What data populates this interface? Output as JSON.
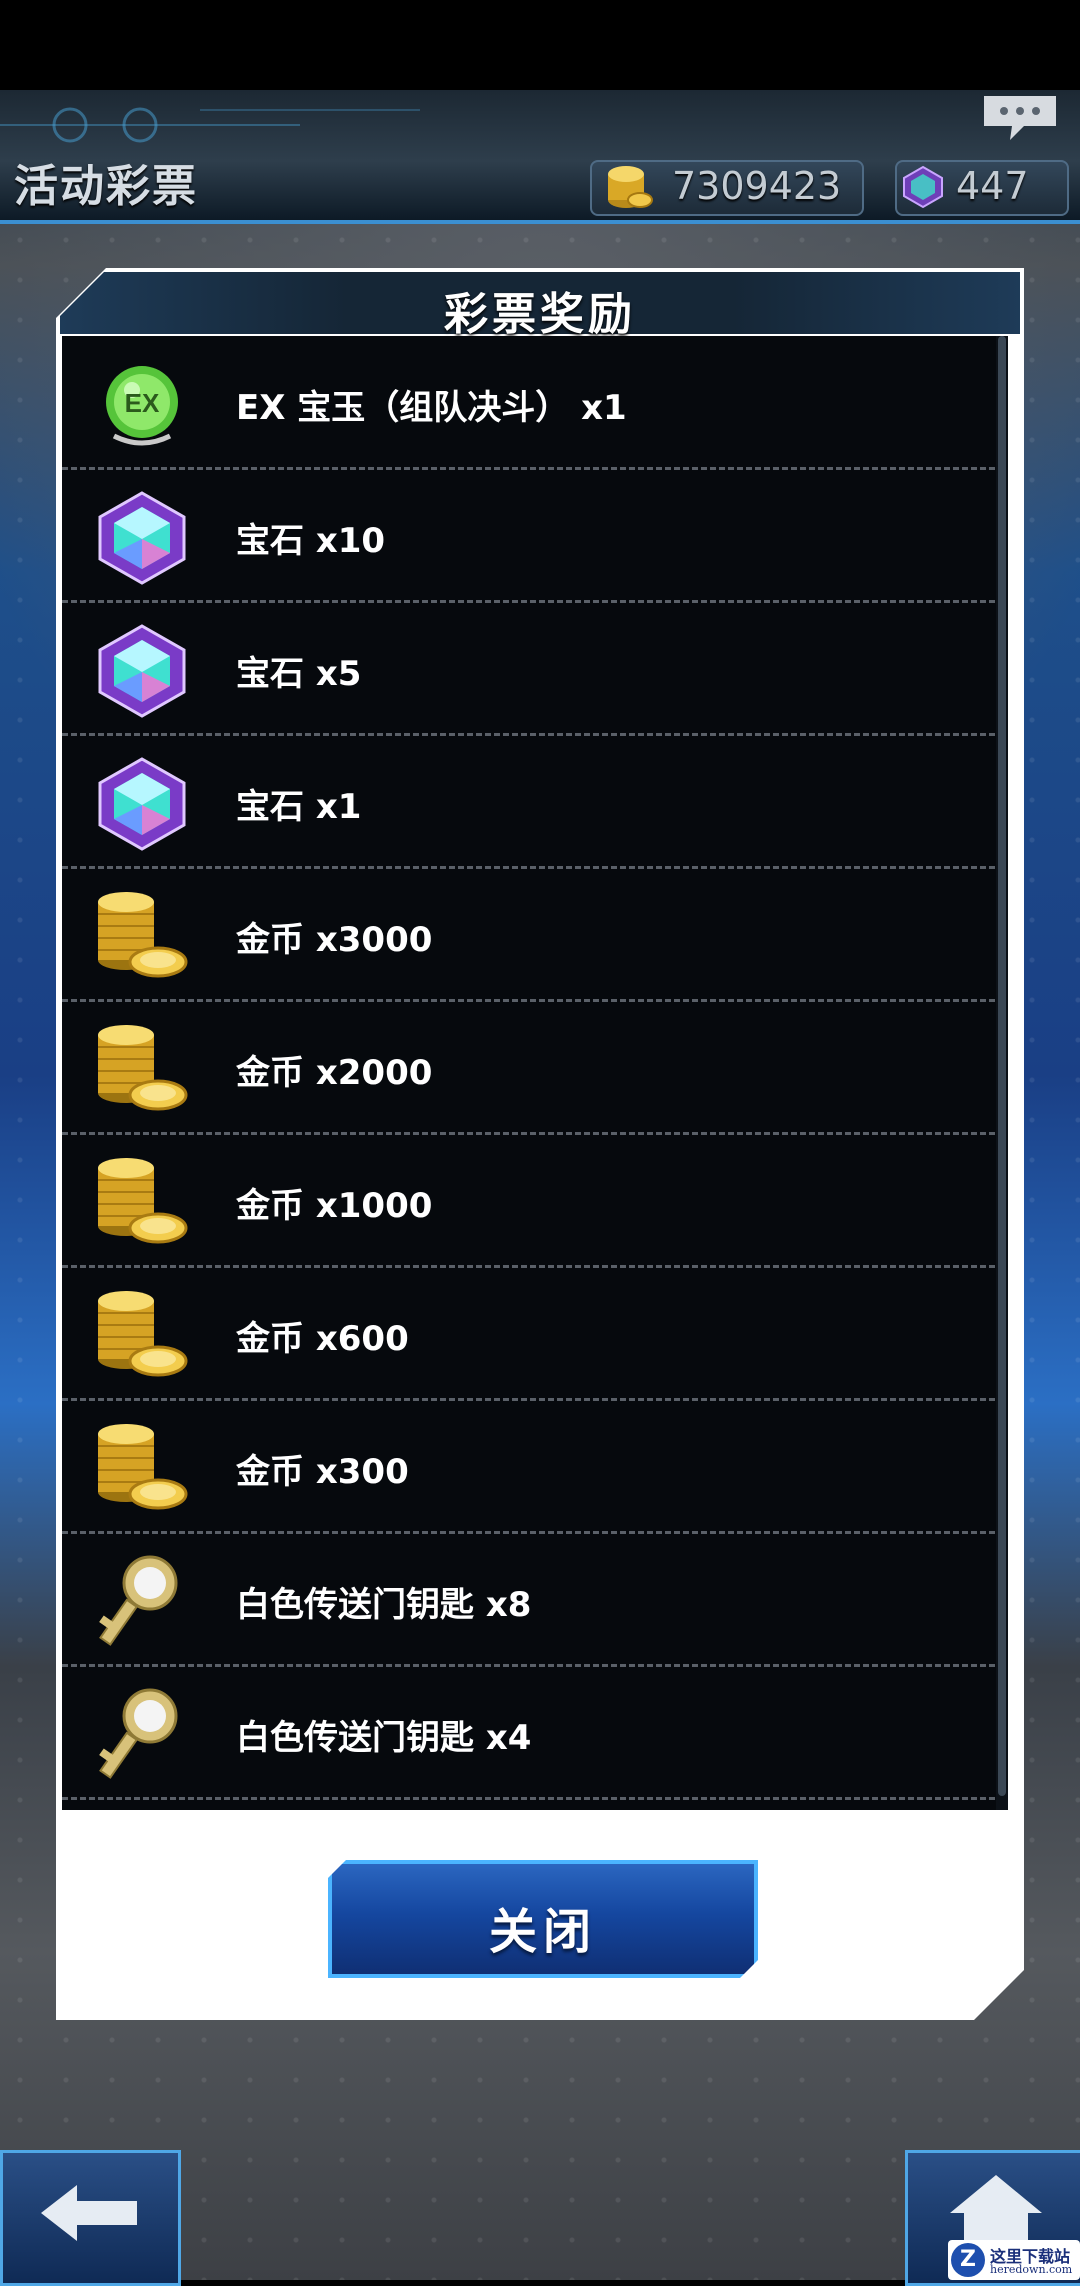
{
  "header": {
    "title": "活动彩票",
    "gold_amount": "7309423",
    "gem_amount": "447"
  },
  "dialog": {
    "title": "彩票奖励",
    "close_label": "关闭",
    "rewards": [
      {
        "icon": "ex-orb-icon",
        "label": "EX 宝玉（组队决斗） x1"
      },
      {
        "icon": "gem-icon",
        "label": "宝石 x10"
      },
      {
        "icon": "gem-icon",
        "label": "宝石 x5"
      },
      {
        "icon": "gem-icon",
        "label": "宝石 x1"
      },
      {
        "icon": "gold-coins-icon",
        "label": "金币 x3000"
      },
      {
        "icon": "gold-coins-icon",
        "label": "金币 x2000"
      },
      {
        "icon": "gold-coins-icon",
        "label": "金币 x1000"
      },
      {
        "icon": "gold-coins-icon",
        "label": "金币 x600"
      },
      {
        "icon": "gold-coins-icon",
        "label": "金币 x300"
      },
      {
        "icon": "white-gate-key-icon",
        "label": "白色传送门钥匙 x8"
      },
      {
        "icon": "white-gate-key-icon",
        "label": "白色传送门钥匙 x4"
      }
    ]
  },
  "watermark": {
    "cn": "这里下载站",
    "en": "heredown.com",
    "logo": "Z"
  },
  "colors": {
    "accent_blue": "#4bb4ff",
    "button_blue": "#1547a0",
    "panel_dark": "#06090d"
  }
}
